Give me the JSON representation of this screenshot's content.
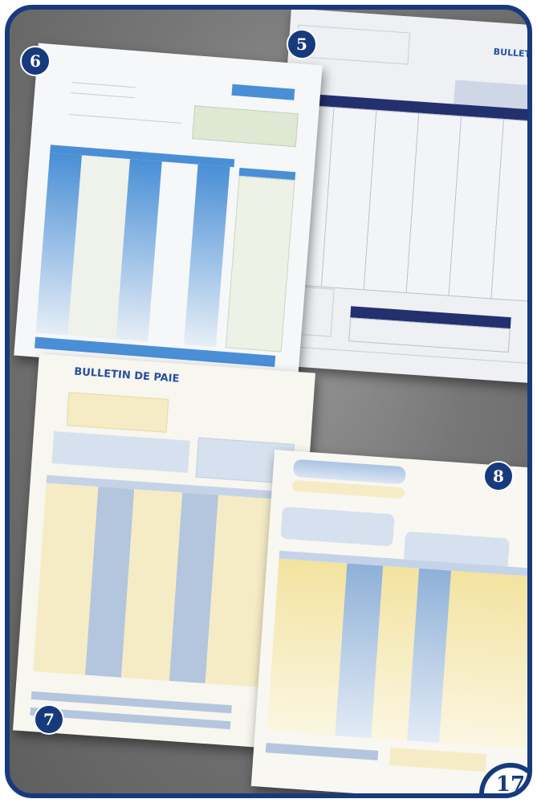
{
  "badges": {
    "b5": "5",
    "b6": "6",
    "b7": "7",
    "b8": "8"
  },
  "sheet5": {
    "title": "BULLETIN"
  },
  "sheet7": {
    "title": "BULLETIN DE PAIE"
  },
  "page_number": "17",
  "colors": {
    "frame": "#173a7d",
    "accent_blue": "#4a8fd6",
    "navy": "#23306e",
    "cream": "#f5ecc6"
  }
}
